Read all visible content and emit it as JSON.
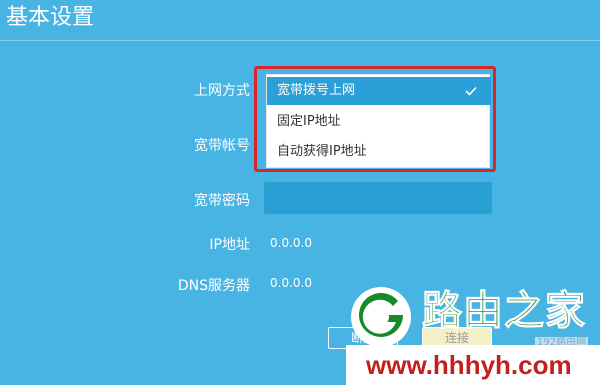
{
  "page": {
    "title": "基本设置"
  },
  "form": {
    "connection_type_label": "上网方式",
    "account_label": "宽带帐号",
    "password_label": "宽带密码",
    "password_value": "",
    "ip_label": "IP地址",
    "ip_value": "0.0.0.0",
    "dns_label": "DNS服务器",
    "dns_value": "0.0.0.0"
  },
  "dropdown": {
    "options": [
      {
        "label": "宽带拨号上网",
        "selected": true
      },
      {
        "label": "固定IP地址",
        "selected": false
      },
      {
        "label": "自动获得IP地址",
        "selected": false
      }
    ]
  },
  "buttons": {
    "disconnect": "断开",
    "connect": "连接"
  },
  "watermark": {
    "brand": "路由之家",
    "url": "www.hhhyh.com",
    "small": "192路由网"
  },
  "colors": {
    "background": "#47b4e3",
    "selected_option": "#2b9fd7",
    "highlight_border": "#d9262a",
    "brand_green": "#168a25",
    "url_red": "#c21f1f"
  }
}
